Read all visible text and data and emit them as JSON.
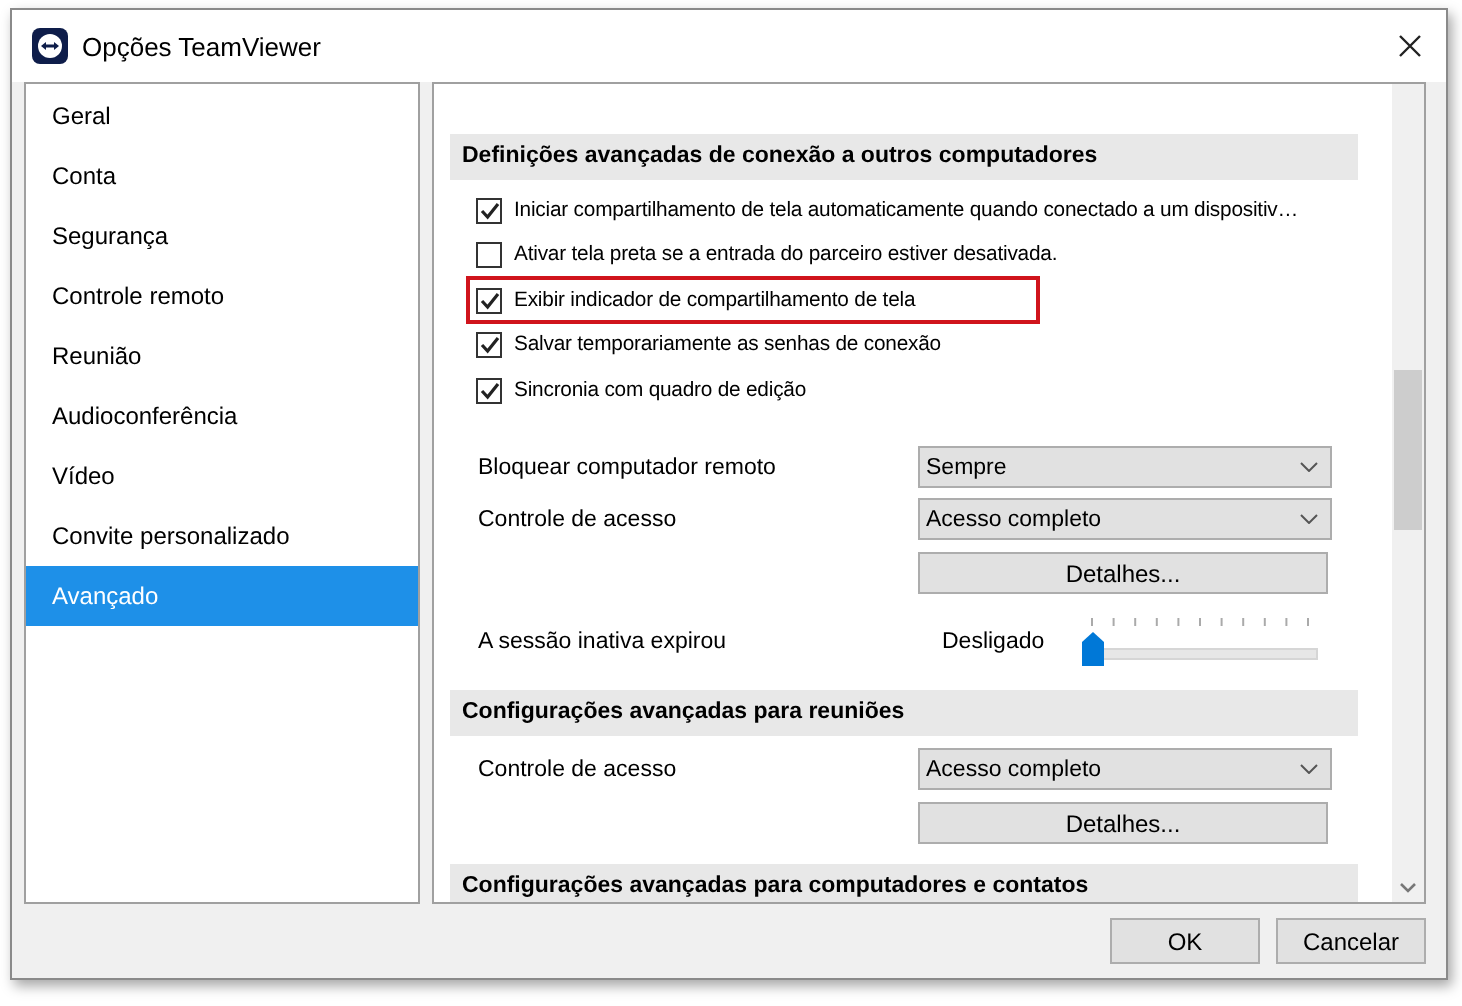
{
  "window": {
    "title": "Opções TeamViewer"
  },
  "sidebar": {
    "items": [
      {
        "label": "Geral",
        "selected": false
      },
      {
        "label": "Conta",
        "selected": false
      },
      {
        "label": "Segurança",
        "selected": false
      },
      {
        "label": "Controle remoto",
        "selected": false
      },
      {
        "label": "Reunião",
        "selected": false
      },
      {
        "label": "Audioconferência",
        "selected": false
      },
      {
        "label": "Vídeo",
        "selected": false
      },
      {
        "label": "Convite personalizado",
        "selected": false
      },
      {
        "label": "Avançado",
        "selected": true
      }
    ]
  },
  "content": {
    "sections": [
      {
        "title": "Definições avançadas de conexão a outros computadores",
        "rows": [
          {
            "kind": "checkbox",
            "label": "Iniciar compartilhamento de tela automaticamente quando conectado a um dispositiv…",
            "checked": true,
            "highlighted": false
          },
          {
            "kind": "checkbox",
            "label": "Ativar tela preta se a entrada do parceiro estiver desativada.",
            "checked": false,
            "highlighted": false
          },
          {
            "kind": "checkbox",
            "label": "Exibir indicador de compartilhamento de tela",
            "checked": true,
            "highlighted": true
          },
          {
            "kind": "checkbox",
            "label": "Salvar temporariamente as senhas de conexão",
            "checked": true,
            "highlighted": false
          },
          {
            "kind": "checkbox",
            "label": "Sincronia com quadro de edição",
            "checked": true,
            "highlighted": false
          },
          {
            "kind": "dropdown",
            "label": "Bloquear computador remoto",
            "value": "Sempre"
          },
          {
            "kind": "dropdown",
            "label": "Controle de acesso",
            "value": "Acesso completo"
          },
          {
            "kind": "button",
            "label": "Detalhes..."
          },
          {
            "kind": "slider",
            "label": "A sessão inativa expirou",
            "reading": "Desligado",
            "level": 0
          }
        ]
      },
      {
        "title": "Configurações avançadas para reuniões",
        "rows": [
          {
            "kind": "dropdown",
            "label": "Controle de acesso",
            "value": "Acesso completo"
          },
          {
            "kind": "button",
            "label": "Detalhes..."
          }
        ]
      },
      {
        "title": "Configurações avançadas para computadores e contatos"
      }
    ]
  },
  "buttons": [
    {
      "label": "OK"
    },
    {
      "label": "Cancelar"
    }
  ]
}
